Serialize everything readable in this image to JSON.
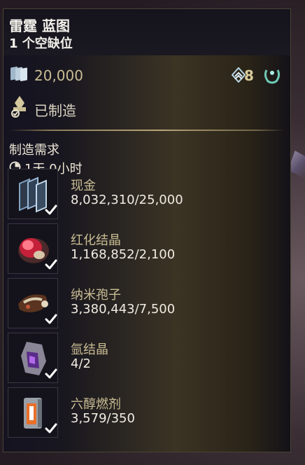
{
  "blueprint": {
    "title": "雷霆 蓝图",
    "subtitle": "1 个空缺位",
    "credits_cost": "20,000",
    "mastery_rank": "8",
    "crafted_label": "已制造"
  },
  "requirements": {
    "heading": "制造需求",
    "build_time": "1天 0小时",
    "items": [
      {
        "name": "现金",
        "count": "8,032,310/25,000",
        "icon": "credits-stack-icon"
      },
      {
        "name": "红化结晶",
        "count": "1,168,852/2,100",
        "icon": "rubedo-icon"
      },
      {
        "name": "纳米孢子",
        "count": "3,380,443/7,500",
        "icon": "nano-spores-icon"
      },
      {
        "name": "氩结晶",
        "count": "4/2",
        "icon": "argon-crystal-icon"
      },
      {
        "name": "六醇燃剂",
        "count": "3,579/350",
        "icon": "hexenon-icon"
      }
    ]
  },
  "colors": {
    "accent_gold": "#c9bd93",
    "panel_bg": "#18161f",
    "check_white": "#ffffff"
  }
}
